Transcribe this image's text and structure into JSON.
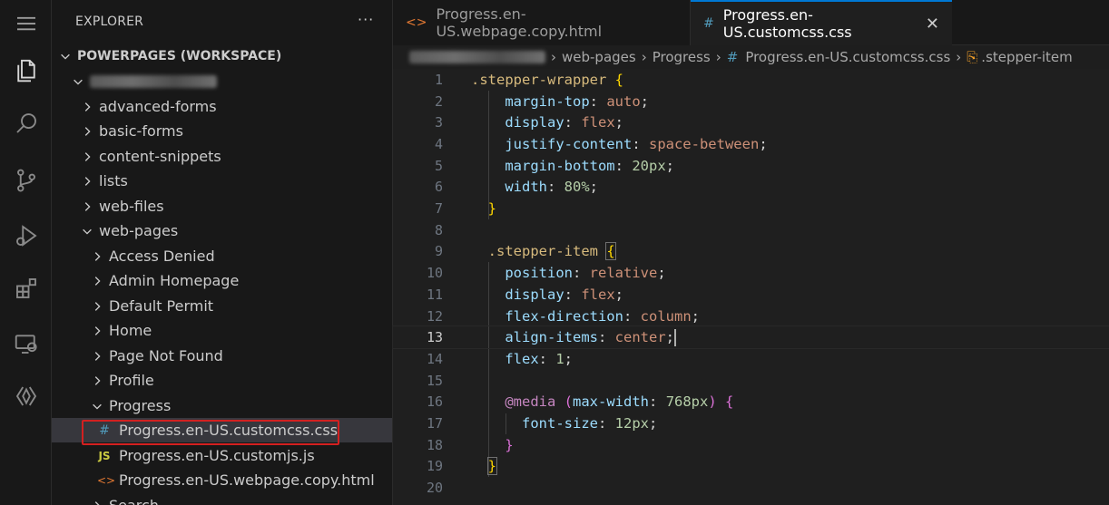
{
  "sidebar": {
    "title": "EXPLORER",
    "more": "···",
    "workspace": "POWERPAGES (WORKSPACE)",
    "items": [
      {
        "label": "advanced-forms"
      },
      {
        "label": "basic-forms"
      },
      {
        "label": "content-snippets"
      },
      {
        "label": "lists"
      },
      {
        "label": "web-files"
      },
      {
        "label": "web-pages"
      },
      {
        "label": "Access Denied"
      },
      {
        "label": "Admin Homepage"
      },
      {
        "label": "Default Permit"
      },
      {
        "label": "Home"
      },
      {
        "label": "Page Not Found"
      },
      {
        "label": "Profile"
      },
      {
        "label": "Progress"
      },
      {
        "label": "Progress.en-US.customcss.css",
        "icon": "#"
      },
      {
        "label": "Progress.en-US.customjs.js",
        "icon": "JS"
      },
      {
        "label": "Progress.en-US.webpage.copy.html",
        "icon": "<>"
      },
      {
        "label": "Search"
      }
    ]
  },
  "tabs": [
    {
      "label": "Progress.en-US.webpage.copy.html",
      "icon": "<>"
    },
    {
      "label": "Progress.en-US.customcss.css",
      "icon": "#",
      "close": "✕"
    }
  ],
  "breadcrumb": {
    "parts": [
      "web-pages",
      "Progress",
      "Progress.en-US.customcss.css",
      ".stepper-item"
    ]
  },
  "editor": {
    "line_numbers": [
      "1",
      "2",
      "3",
      "4",
      "5",
      "6",
      "7",
      "8",
      "9",
      "10",
      "11",
      "12",
      "13",
      "14",
      "15",
      "16",
      "17",
      "18",
      "19",
      "20"
    ],
    "current_line": 13,
    "lines": {
      "l1_sel": ".stepper-wrapper",
      "l1_brace": "{",
      "l2_prop": "margin-top",
      "l2_val": "auto",
      "l3_prop": "display",
      "l3_val": "flex",
      "l4_prop": "justify-content",
      "l4_val": "space-between",
      "l5_prop": "margin-bottom",
      "l5_val": "20px",
      "l6_prop": "width",
      "l6_val": "80%",
      "l7_brace": "}",
      "l9_sel": ".stepper-item",
      "l9_brace": "{",
      "l10_prop": "position",
      "l10_val": "relative",
      "l11_prop": "display",
      "l11_val": "flex",
      "l12_prop": "flex-direction",
      "l12_val": "column",
      "l13_prop": "align-items",
      "l13_val": "center",
      "l14_prop": "flex",
      "l14_val": "1",
      "l16_at": "@media",
      "l16_open": "(",
      "l16_prop": "max-width",
      "l16_val": "768px",
      "l16_close": ")",
      "l16_brace": "{",
      "l17_prop": "font-size",
      "l17_val": "12px",
      "l18_brace": "}",
      "l19_brace": "}"
    }
  },
  "colors": {
    "accent": "#0078d4",
    "highlight_box": "#d32020"
  }
}
